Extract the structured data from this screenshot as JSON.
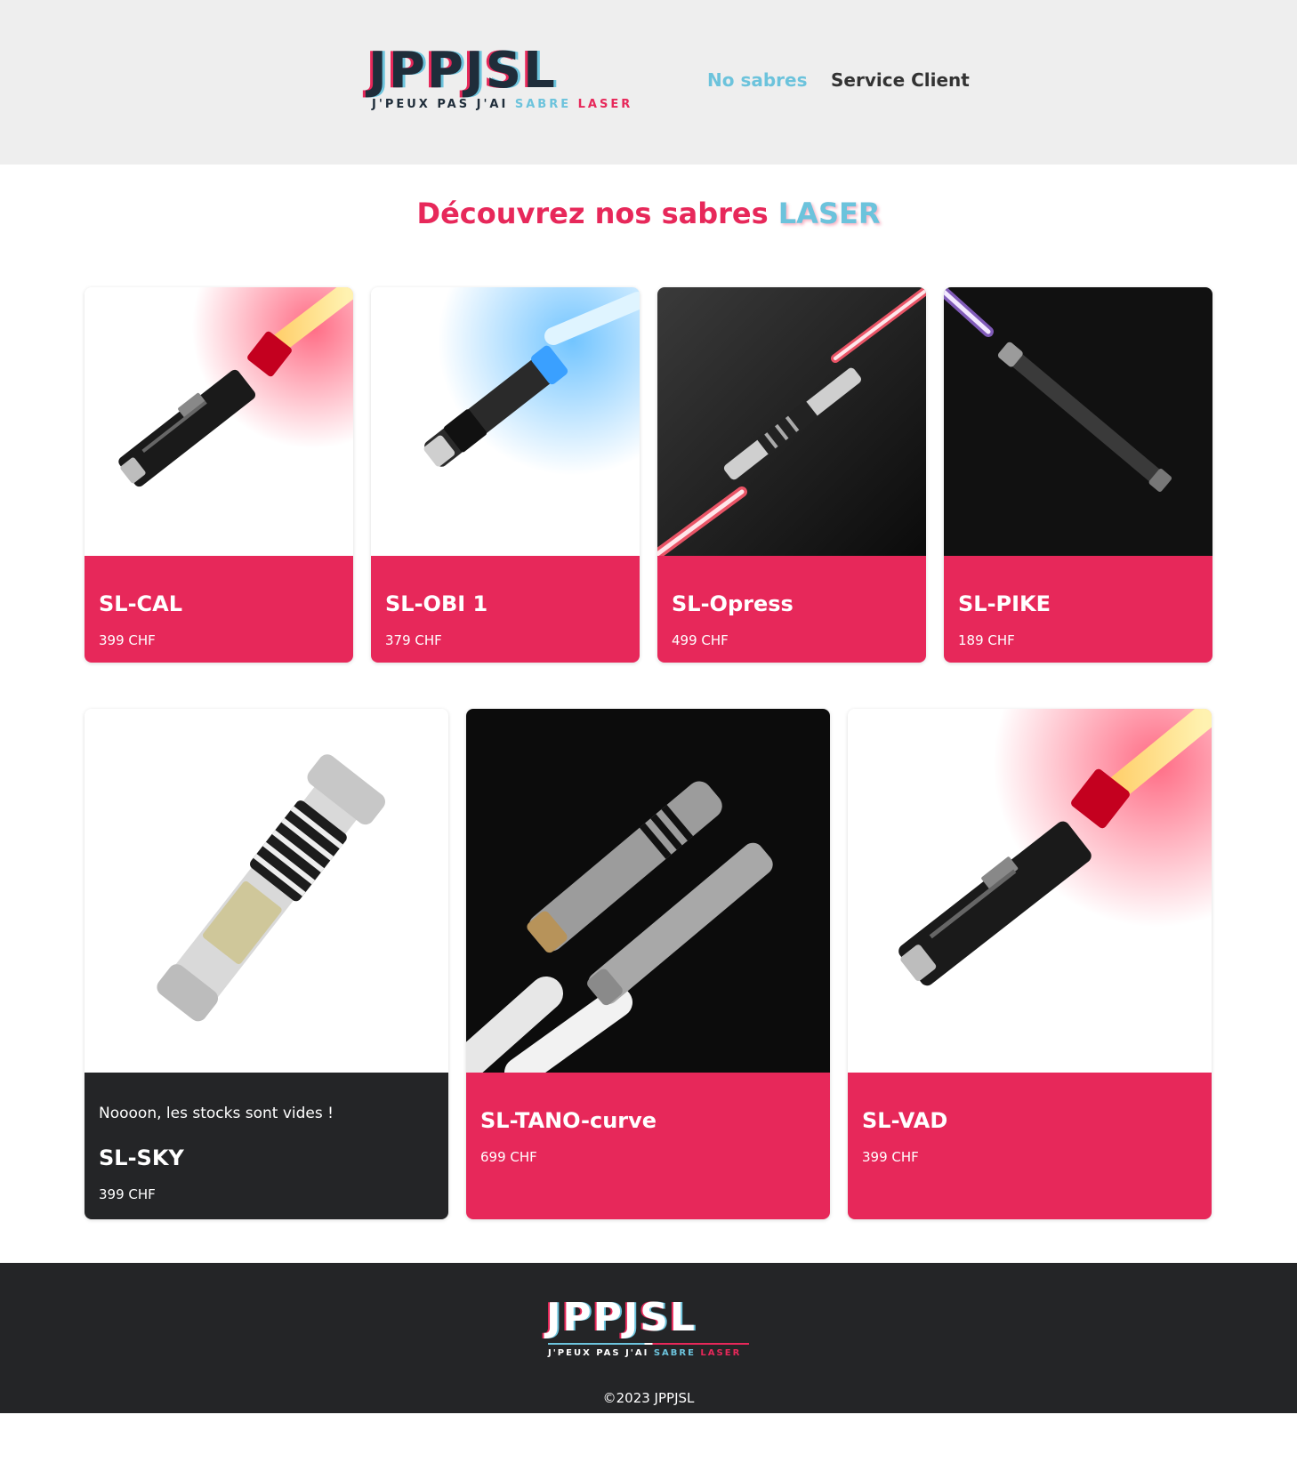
{
  "header": {
    "logo": {
      "main": "JPPJSL",
      "sub_prefix": "J'PEUX PAS J'AI",
      "sub_blue": "SABRE",
      "sub_red": "LASER"
    },
    "nav": [
      {
        "label": "No sabres",
        "active": true
      },
      {
        "label": "Service Client",
        "active": false
      }
    ]
  },
  "main": {
    "title_prefix": "Découvrez nos sabres",
    "title_accent": "LASER",
    "products": [
      {
        "name": "SL-CAL",
        "price": "399 CHF"
      },
      {
        "name": "SL-OBI 1",
        "price": "379 CHF"
      },
      {
        "name": "SL-Opress",
        "price": "499 CHF"
      },
      {
        "name": "SL-PIKE",
        "price": "189 CHF"
      },
      {
        "name": "SL-SKY",
        "price": "399 CHF",
        "stock_message": "Noooon, les stocks sont vides !"
      },
      {
        "name": "SL-TANO-curve",
        "price": "699 CHF"
      },
      {
        "name": "SL-VAD",
        "price": "399 CHF"
      }
    ]
  },
  "footer": {
    "logo": {
      "main": "JPPJSL",
      "sub_prefix": "J'PEUX PAS J'AI",
      "sub_blue": "SABRE",
      "sub_red": "LASER"
    },
    "copyright": "©2023 JPPJSL"
  },
  "colors": {
    "brand_red": "#e7285a",
    "brand_blue": "#6cc3dc",
    "dark": "#242527",
    "header_bg": "#eeeeee"
  }
}
